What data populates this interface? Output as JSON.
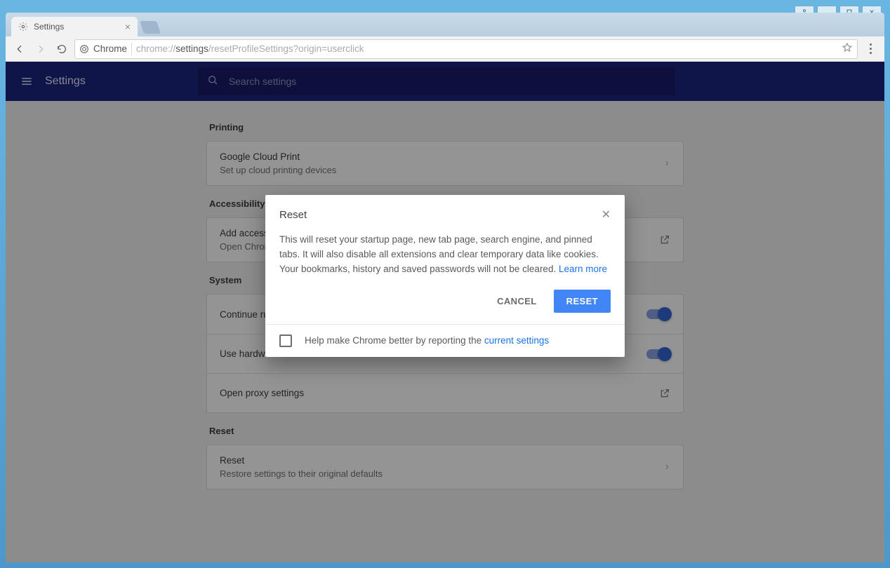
{
  "window": {
    "controls": [
      "user",
      "min",
      "max",
      "close"
    ]
  },
  "browser": {
    "tab_title": "Settings",
    "omnibox_chip": "Chrome",
    "url_prefix": "chrome://",
    "url_seg": "settings",
    "url_suffix": "/resetProfileSettings?origin=userclick"
  },
  "appbar": {
    "title": "Settings",
    "search_placeholder": "Search settings"
  },
  "sections": {
    "printing": {
      "title": "Printing",
      "item_title": "Google Cloud Print",
      "item_sub": "Set up cloud printing devices"
    },
    "accessibility": {
      "title": "Accessibility",
      "item_title": "Add accessibility features",
      "item_sub": "Open Chrome Web Store"
    },
    "system": {
      "title": "System",
      "row1": "Continue running background apps when Google Chrome is closed",
      "row2": "Use hardware acceleration when available",
      "row3": "Open proxy settings"
    },
    "reset": {
      "title": "Reset",
      "item_title": "Reset",
      "item_sub": "Restore settings to their original defaults"
    }
  },
  "dialog": {
    "title": "Reset",
    "body": "This will reset your startup page, new tab page, search engine, and pinned tabs. It will also disable all extensions and clear temporary data like cookies. Your bookmarks, history and saved passwords will not be cleared. ",
    "learn_more": "Learn more",
    "cancel": "CANCEL",
    "confirm": "RESET",
    "footer_prefix": "Help make Chrome better by reporting the ",
    "footer_link": "current settings"
  }
}
